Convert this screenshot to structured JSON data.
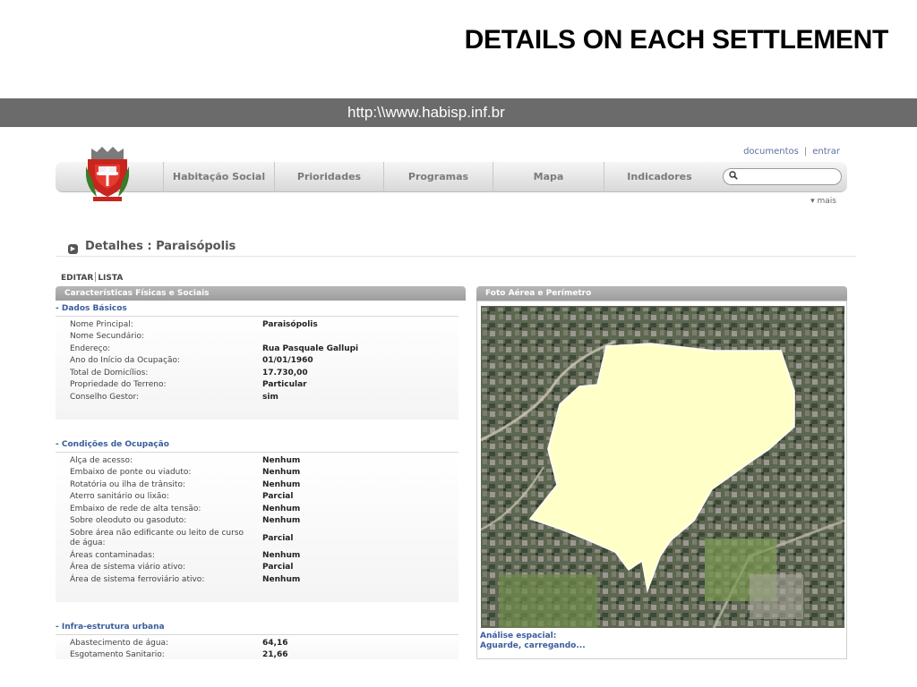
{
  "slide": {
    "title": "DETAILS ON EACH SETTLEMENT",
    "url": "http:\\\\www.habisp.inf.br"
  },
  "header": {
    "links": [
      "documentos",
      "entrar"
    ],
    "link_separator": "|"
  },
  "nav": {
    "items": [
      "Habitação Social",
      "Prioridades",
      "Programas",
      "Mapa",
      "Indicadores"
    ],
    "search_placeholder": "",
    "more_label": "▾ mais"
  },
  "page": {
    "title": "Detalhes : Paraisópolis",
    "actions": [
      "EDITAR",
      "LISTA"
    ]
  },
  "left_panel": {
    "title": "Características Físicas e Sociais",
    "sections": [
      {
        "title": "- Dados Básicos",
        "rows": [
          {
            "label": "Nome Principal:",
            "value": "Paraisópolis"
          },
          {
            "label": "Nome Secundário:",
            "value": ""
          },
          {
            "label": "Endereço:",
            "value": "Rua Pasquale Gallupi"
          },
          {
            "label": "Ano do Início da Ocupação:",
            "value": "01/01/1960"
          },
          {
            "label": "Total de Domicílios:",
            "value": "17.730,00"
          },
          {
            "label": "Propriedade do Terreno:",
            "value": "Particular"
          },
          {
            "label": "Conselho Gestor:",
            "value": "sim"
          }
        ]
      },
      {
        "title": "- Condições de Ocupação",
        "rows": [
          {
            "label": "Alça de acesso:",
            "value": "Nenhum"
          },
          {
            "label": "Embaixo de ponte ou viaduto:",
            "value": "Nenhum"
          },
          {
            "label": "Rotatória ou ilha de trânsito:",
            "value": "Nenhum"
          },
          {
            "label": "Aterro sanitário ou lixão:",
            "value": "Parcial"
          },
          {
            "label": "Embaixo de rede de alta tensão:",
            "value": "Nenhum"
          },
          {
            "label": "Sobre oleoduto ou gasoduto:",
            "value": "Nenhum"
          },
          {
            "label": "Sobre área não edificante ou leito de curso de água:",
            "value": "Parcial"
          },
          {
            "label": "Áreas contaminadas:",
            "value": "Nenhum"
          },
          {
            "label": "Área de sistema viário ativo:",
            "value": "Parcial"
          },
          {
            "label": "Área de sistema ferroviário ativo:",
            "value": "Nenhum"
          }
        ]
      },
      {
        "title": "- Infra-estrutura urbana",
        "rows": [
          {
            "label": "Abastecimento de água:",
            "value": "64,16"
          },
          {
            "label": "Esgotamento Sanitario:",
            "value": "21,66"
          }
        ]
      }
    ]
  },
  "right_panel": {
    "title": "Foto Aérea e Perímetro",
    "caption_label": "Análise espacial:",
    "caption_status": "Aguarde, carregando...",
    "colors": {
      "perimeter_fill": "#ffffc8",
      "perimeter_stroke": "#ffffff"
    }
  }
}
